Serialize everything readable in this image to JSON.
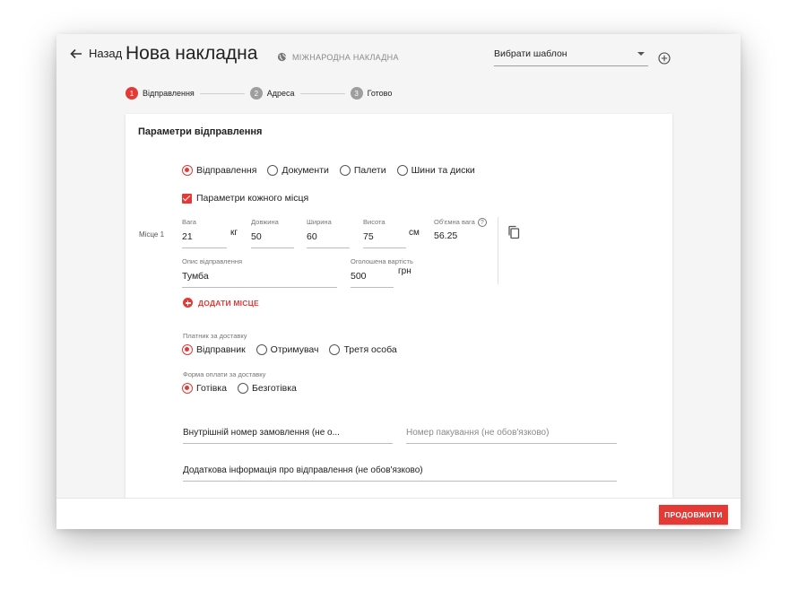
{
  "header": {
    "back_label": "Назад",
    "title": "Нова накладна",
    "international_label": "МІЖНАРОДНА НАКЛАДНА",
    "template_select": "Вибрати шаблон"
  },
  "stepper": [
    {
      "num": "1",
      "label": "Відправлення",
      "active": true
    },
    {
      "num": "2",
      "label": "Адреса",
      "active": false
    },
    {
      "num": "3",
      "label": "Готово",
      "active": false
    }
  ],
  "shipment": {
    "section_title": "Параметри відправлення",
    "types": [
      {
        "label": "Відправлення",
        "selected": true
      },
      {
        "label": "Документи",
        "selected": false
      },
      {
        "label": "Палети",
        "selected": false
      },
      {
        "label": "Шини та диски",
        "selected": false
      }
    ],
    "per_place_label": "Параметри кожного місця",
    "place_label": "Місце 1",
    "weight": {
      "label": "Вага",
      "value": "21",
      "unit": "кг"
    },
    "length": {
      "label": "Довжина",
      "value": "50"
    },
    "width": {
      "label": "Ширина",
      "value": "60"
    },
    "height": {
      "label": "Висота",
      "value": "75",
      "unit": "см"
    },
    "volume_weight": {
      "label": "Об'ємна вага",
      "value": "56.25",
      "help": "?"
    },
    "description": {
      "label": "Опис відправлення",
      "value": "Тумба"
    },
    "declared_value": {
      "label": "Оголошена вартість",
      "value": "500",
      "unit": "грн"
    },
    "add_place_label": "ДОДАТИ МІСЦЕ",
    "payer_label": "Платник за доставку",
    "payers": [
      {
        "label": "Відправник",
        "selected": true
      },
      {
        "label": "Отримувач",
        "selected": false
      },
      {
        "label": "Третя особа",
        "selected": false
      }
    ],
    "payment_label": "Форма оплати за доставку",
    "payments": [
      {
        "label": "Готівка",
        "selected": true
      },
      {
        "label": "Безготівка",
        "selected": false
      }
    ],
    "order_number": "Внутрішній номер замовлення (не о...",
    "package_number_placeholder": "Номер пакування (не обов'язково)",
    "additional_info": "Додаткова інформація про відправлення (не обов'язково)"
  },
  "footer": {
    "continue_label": "ПРОДОВЖИТИ"
  },
  "colors": {
    "accent": "#e53935",
    "background": "#f5f5f5"
  }
}
